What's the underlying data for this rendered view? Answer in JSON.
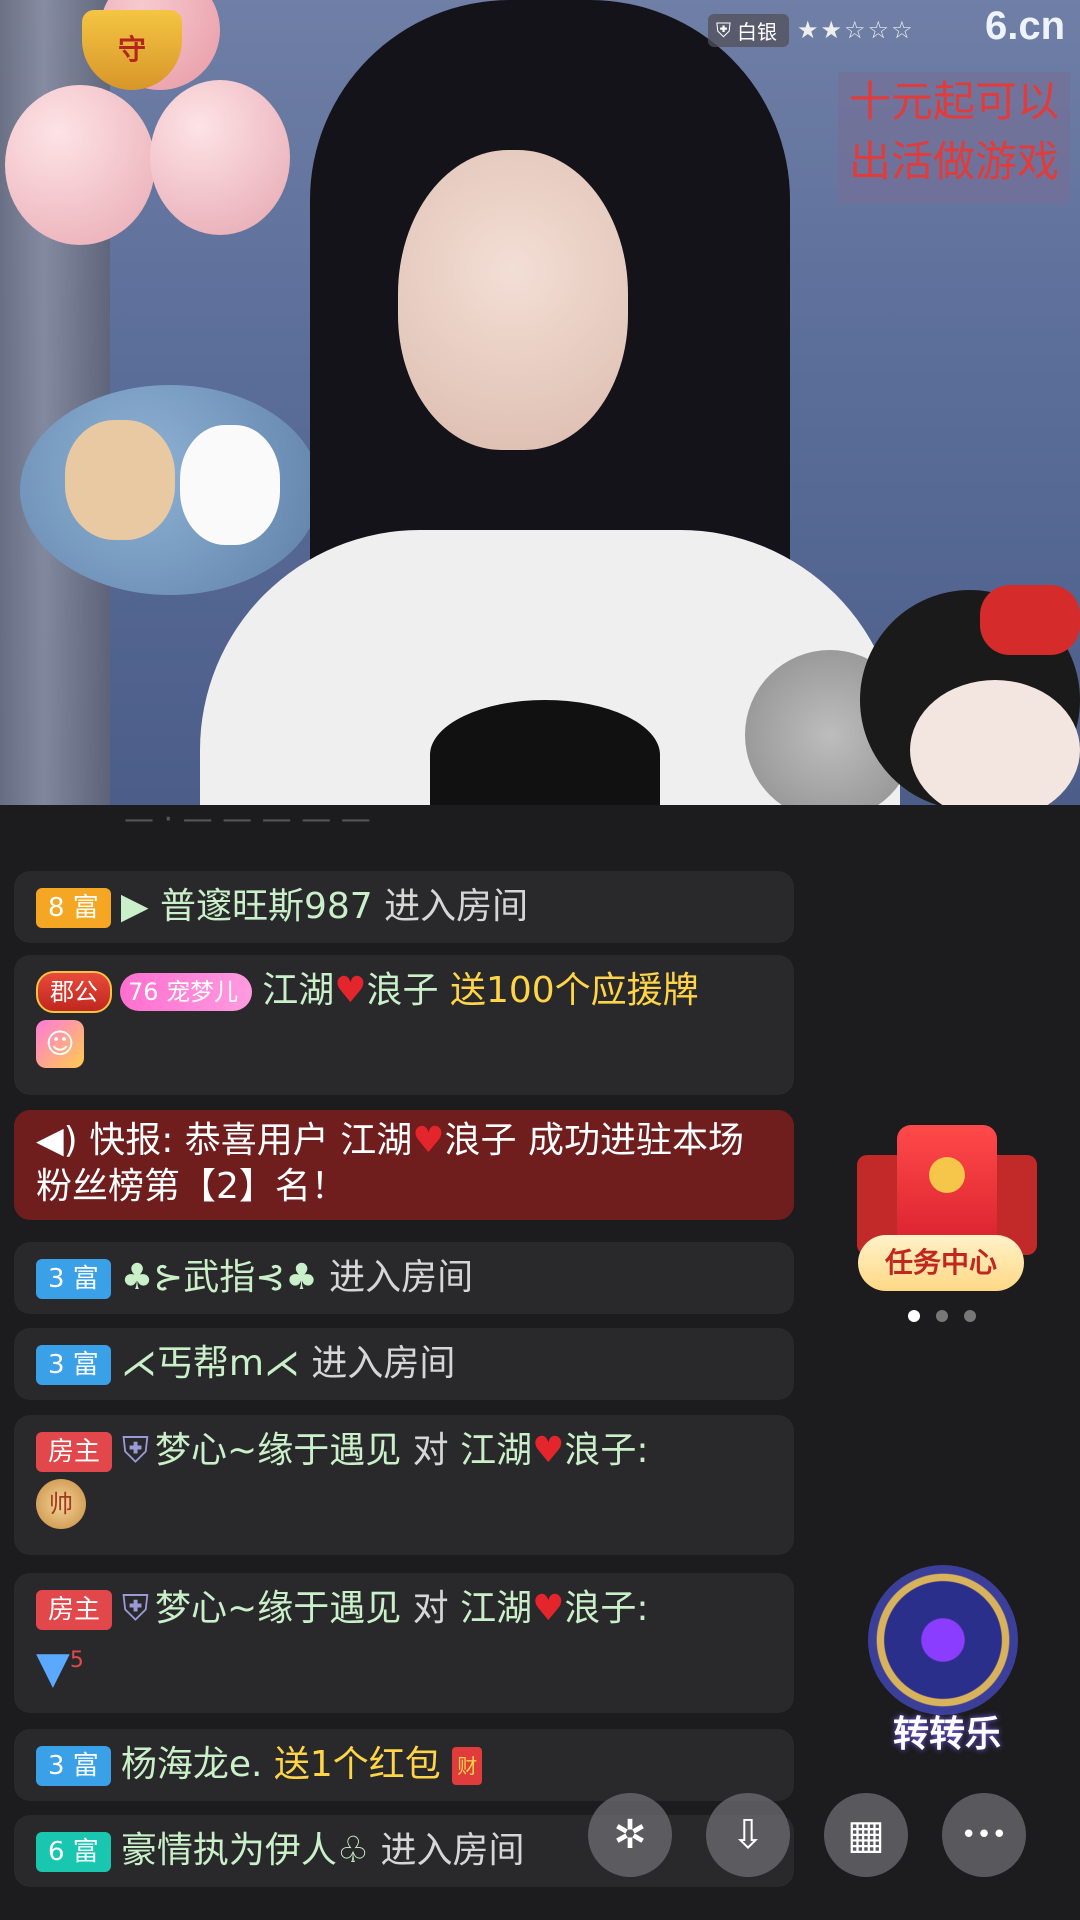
{
  "video": {
    "rank_label": "白银",
    "stars": "★★☆☆☆",
    "site_logo": "6.cn",
    "promo_line1": "十元起可以",
    "promo_line2": "出活做游戏"
  },
  "chat": [
    {
      "level": "8 富",
      "prefix": "▶",
      "name": "普邃旺斯987",
      "action": "进入房间"
    },
    {
      "badge1": "郡公",
      "badge2": "宠梦儿",
      "badge2_num": "76",
      "name_a": "江湖",
      "name_b": "浪子",
      "gift_text": "送100个应援牌"
    },
    {
      "alert_prefix": "快报:",
      "alert_text1": "恭喜用户 江湖",
      "alert_text2": "浪子 成功进驻本场",
      "alert_text3": "粉丝榜第【2】名！"
    },
    {
      "level": "3 富",
      "name": "♣⊱武指⊰♣",
      "action": "进入房间"
    },
    {
      "level": "3 富",
      "name": "⋌丐帮m⋌",
      "action": "进入房间"
    },
    {
      "level": "房主",
      "name": "梦心~缘于遇见",
      "mid": "对",
      "target_a": "江湖",
      "target_b": "浪子:",
      "token": "帅"
    },
    {
      "level": "房主",
      "name": "梦心~缘于遇见",
      "mid": "对",
      "target_a": "江湖",
      "target_b": "浪子:",
      "token": "5"
    },
    {
      "level": "3 富",
      "name": "杨海龙e.",
      "gift_text": "送1个红包",
      "packet": "财"
    },
    {
      "level": "6 富",
      "name": "豪情执为伊人♧",
      "action": "进入房间"
    }
  ],
  "widgets": {
    "task_label": "任务中心",
    "wheel_label": "转转乐"
  },
  "toolbar": {
    "share_icon": "✲",
    "download_icon": "⇩",
    "grid_icon": "▦",
    "more_icon": "•••"
  }
}
